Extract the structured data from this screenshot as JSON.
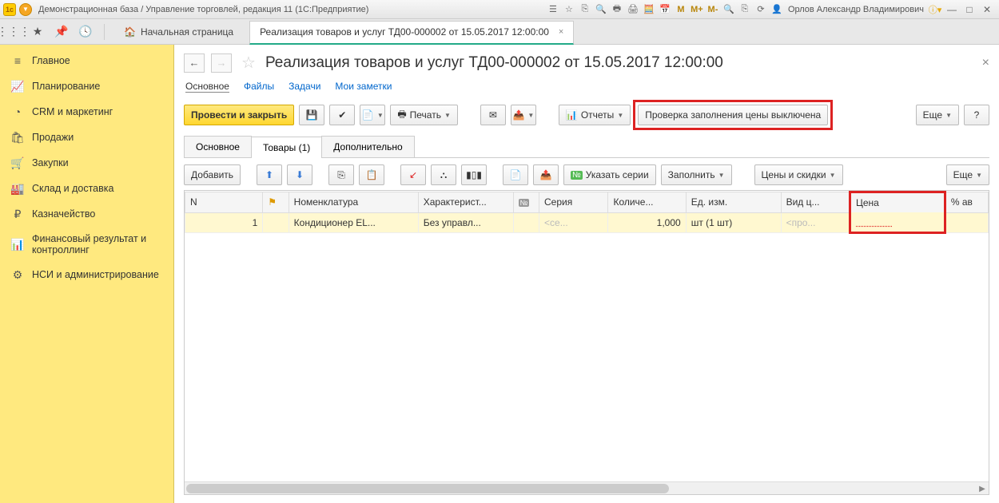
{
  "titlebar": {
    "title": "Демонстрационная база / Управление торговлей, редакция 11  (1С:Предприятие)",
    "m": "M",
    "mplus": "M+",
    "mminus": "M-",
    "user": "Орлов Александр Владимирович"
  },
  "tabrow": {
    "home": "Начальная страница",
    "doc_tab": "Реализация товаров и услуг ТД00-000002 от 15.05.2017 12:00:00"
  },
  "sidebar": {
    "items": [
      {
        "icon": "menu",
        "label": "Главное"
      },
      {
        "icon": "chart",
        "label": "Планирование"
      },
      {
        "icon": "pie",
        "label": "CRM и маркетинг"
      },
      {
        "icon": "bag",
        "label": "Продажи"
      },
      {
        "icon": "cart",
        "label": "Закупки"
      },
      {
        "icon": "warehouse",
        "label": "Склад и доставка"
      },
      {
        "icon": "ruble",
        "label": "Казначейство"
      },
      {
        "icon": "bars",
        "label": "Финансовый результат и контроллинг"
      },
      {
        "icon": "gear",
        "label": "НСИ и администрирование"
      }
    ]
  },
  "doc": {
    "title": "Реализация товаров и услуг ТД00-000002 от 15.05.2017 12:00:00",
    "subtabs": {
      "main": "Основное",
      "files": "Файлы",
      "tasks": "Задачи",
      "notes": "Мои заметки"
    },
    "buttons": {
      "post_close": "Провести и закрыть",
      "print": "Печать",
      "reports": "Отчеты",
      "price_check": "Проверка заполнения цены выключена",
      "more": "Еще",
      "help": "?"
    },
    "tabs": {
      "main": "Основное",
      "goods": "Товары (1)",
      "extra": "Дополнительно"
    },
    "tblbar": {
      "add": "Добавить",
      "series": "Указать серии",
      "fill": "Заполнить",
      "prices": "Цены и скидки",
      "more": "Еще"
    },
    "cols": {
      "n": "N",
      "nomen": "Номенклатура",
      "charact": "Характерист...",
      "series": "Серия",
      "qty": "Количе...",
      "unit": "Ед. изм.",
      "kind": "Вид ц...",
      "price": "Цена",
      "pctav": "% ав"
    },
    "rows": [
      {
        "n": "1",
        "nomen": "Кондиционер EL...",
        "charact": "Без управл...",
        "series": "<се...",
        "qty": "1,000",
        "unit": "шт (1 шт)",
        "kind": "<про...",
        "price": ""
      }
    ]
  }
}
